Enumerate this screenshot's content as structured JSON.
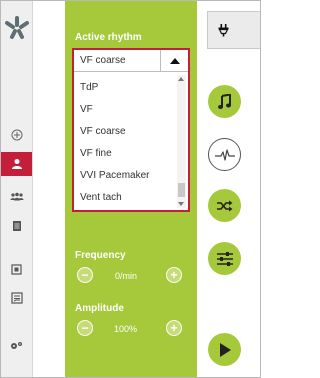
{
  "colors": {
    "panel": "#a6c83b",
    "accent_red": "#c31f3b",
    "sidebar": "#efefef"
  },
  "rhythm": {
    "label": "Active rhythm",
    "selected": "VF coarse",
    "options": [
      "TdP",
      "VF",
      "VF coarse",
      "VF fine",
      "VVI Pacemaker",
      "Vent tach"
    ],
    "scroll_fraction": 0.85
  },
  "frequency": {
    "label": "Frequency",
    "value": "0/min",
    "dec_label": "−",
    "inc_label": "+"
  },
  "amplitude": {
    "label": "Amplitude",
    "value": "100%",
    "dec_label": "−",
    "inc_label": "+"
  },
  "sidebar_icons": [
    "plus-circle-icon",
    "person-icon",
    "group-icon",
    "document-icon",
    "monitor-icon",
    "checklist-icon",
    "gears-icon"
  ],
  "right_icons": [
    "plug-icon",
    "music-note-icon",
    "ecg-pulse-icon",
    "shuffle-icon",
    "sliders-icon",
    "play-icon"
  ]
}
